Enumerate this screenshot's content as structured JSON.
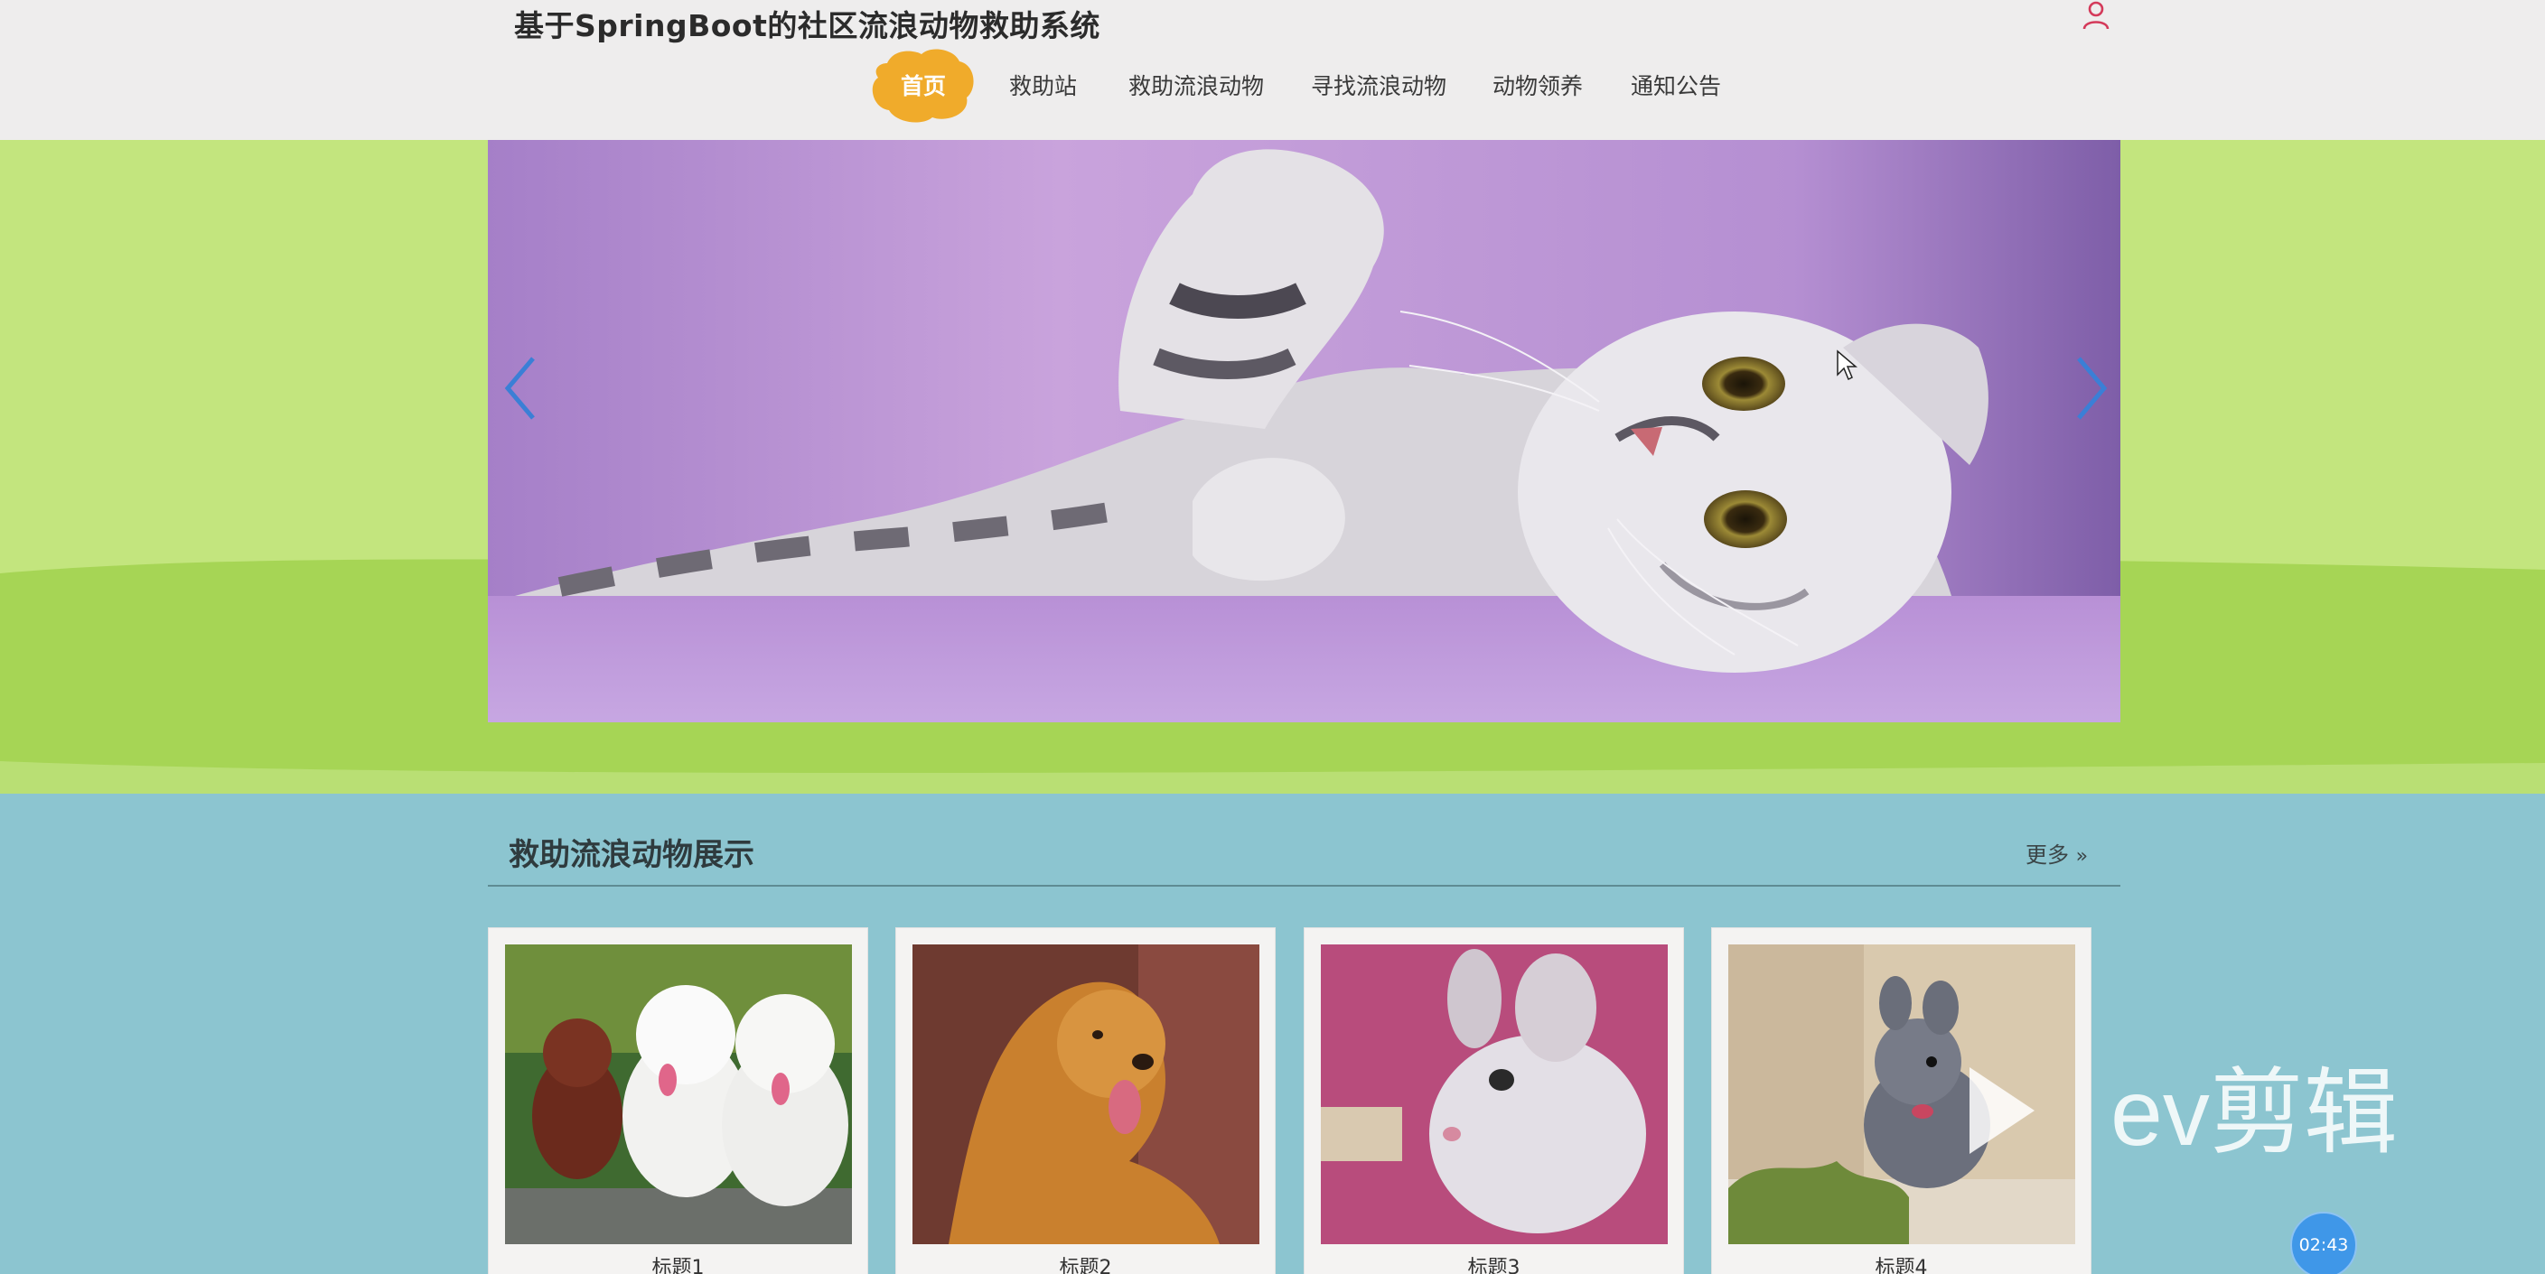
{
  "site": {
    "title": "基于SpringBoot的社区流浪动物救助系统"
  },
  "nav": {
    "items": [
      "首页",
      "救助站",
      "救助流浪动物",
      "寻找流浪动物",
      "动物领养",
      "通知公告"
    ],
    "active_index": 0
  },
  "icons": {
    "user": "user-icon",
    "prev": "chevron-left-icon",
    "next": "chevron-right-icon",
    "more": "double-chevron-right-icon",
    "play": "play-icon"
  },
  "section": {
    "title": "救助流浪动物展示",
    "more_label": "更多"
  },
  "cards": [
    {
      "caption": "标题1",
      "image": "dogs-poodles-photo"
    },
    {
      "caption": "标题2",
      "image": "golden-retriever-photo"
    },
    {
      "caption": "标题3",
      "image": "chinchilla-white-photo"
    },
    {
      "caption": "标题4",
      "image": "chinchilla-grey-photo"
    }
  ],
  "watermark": {
    "text": "ev剪辑"
  },
  "timer": {
    "text": "02:43"
  },
  "colors": {
    "header_bg": "#eeeded",
    "nav_active_blob": "#f0ab2b",
    "hero_bg": "#c3e57e",
    "hero_stripe": "#a6d555",
    "banner_bg": "#b793d4",
    "section_bg": "#8cc5d0",
    "arrow": "#3b7fd6",
    "user_icon": "#d43a5a"
  }
}
